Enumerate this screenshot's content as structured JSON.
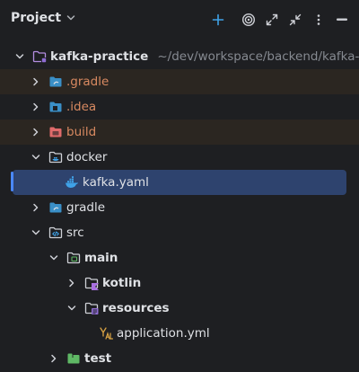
{
  "header": {
    "title": "Project"
  },
  "tree": {
    "root": {
      "label": "kafka-practice",
      "path": "~/dev/workspace/backend/kafka-practice"
    },
    "items": [
      {
        "label": ".gradle"
      },
      {
        "label": ".idea"
      },
      {
        "label": "build"
      },
      {
        "label": "docker"
      },
      {
        "label": "kafka.yaml"
      },
      {
        "label": "gradle"
      },
      {
        "label": "src"
      },
      {
        "label": "main"
      },
      {
        "label": "kotlin"
      },
      {
        "label": "resources"
      },
      {
        "label": "application.yml"
      },
      {
        "label": "test"
      }
    ]
  },
  "colors": {
    "background": "#1e1f22",
    "selection": "#2e436e",
    "excluded_row": "#2b2621",
    "excluded_text": "#d98a61",
    "accent": "#4a88ff",
    "muted_text": "#868a91"
  },
  "icons": {
    "toolbar": [
      "plus-icon",
      "target-icon",
      "expand-icon",
      "collapse-icon",
      "more-icon",
      "minimize-icon"
    ]
  }
}
